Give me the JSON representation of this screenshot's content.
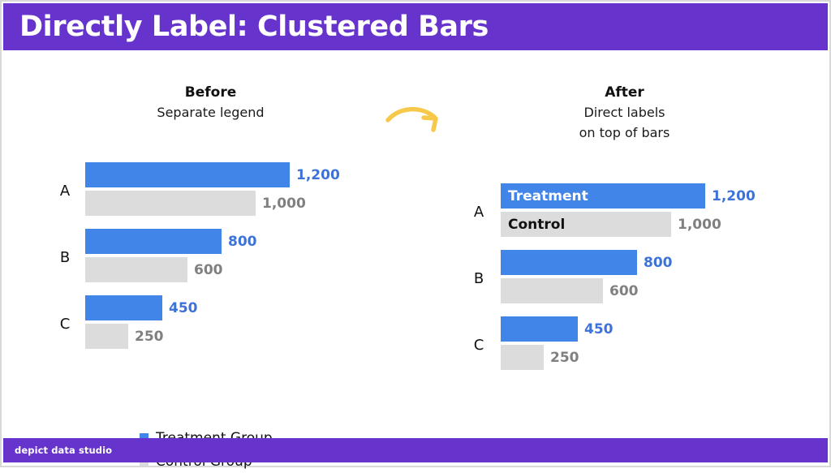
{
  "slide": {
    "title": "Directly Label: Clustered Bars",
    "footer": "depict data studio",
    "brand_purple": "#6633CC",
    "treatment_color": "#4285E8",
    "control_color": "#DCDCDC",
    "arrow_color": "#F7C94B"
  },
  "panels": {
    "before": {
      "title": "Before",
      "subtitle_line1": "Separate legend",
      "subtitle_line2": ""
    },
    "after": {
      "title": "After",
      "subtitle_line1": "Direct labels",
      "subtitle_line2": "on top of bars"
    }
  },
  "legend": {
    "items": [
      {
        "label": "Treatment Group",
        "color": "#4285E8"
      },
      {
        "label": "Control Group",
        "color": "#DCDCDC"
      }
    ]
  },
  "series_names": {
    "treatment": "Treatment",
    "control": "Control"
  },
  "chart_data": {
    "type": "bar",
    "orientation": "horizontal",
    "title": "Directly Label: Clustered Bars",
    "xlabel": "",
    "ylabel": "",
    "categories": [
      "A",
      "B",
      "C"
    ],
    "series": [
      {
        "name": "Treatment Group",
        "short_name": "Treatment",
        "color": "#4285E8",
        "values": [
          1200,
          800,
          450
        ],
        "value_labels": [
          "1,200",
          "800",
          "450"
        ]
      },
      {
        "name": "Control Group",
        "short_name": "Control",
        "color": "#DCDCDC",
        "values": [
          1000,
          600,
          250
        ],
        "value_labels": [
          "1,000",
          "600",
          "250"
        ]
      }
    ],
    "xlim": [
      0,
      1200
    ],
    "grid": false,
    "legend_position": "bottom-left",
    "variants": [
      {
        "id": "before",
        "label": "Before",
        "note": "Separate legend",
        "direct_labels": false
      },
      {
        "id": "after",
        "label": "After",
        "note": "Direct labels on top of bars",
        "direct_labels": true
      }
    ]
  }
}
